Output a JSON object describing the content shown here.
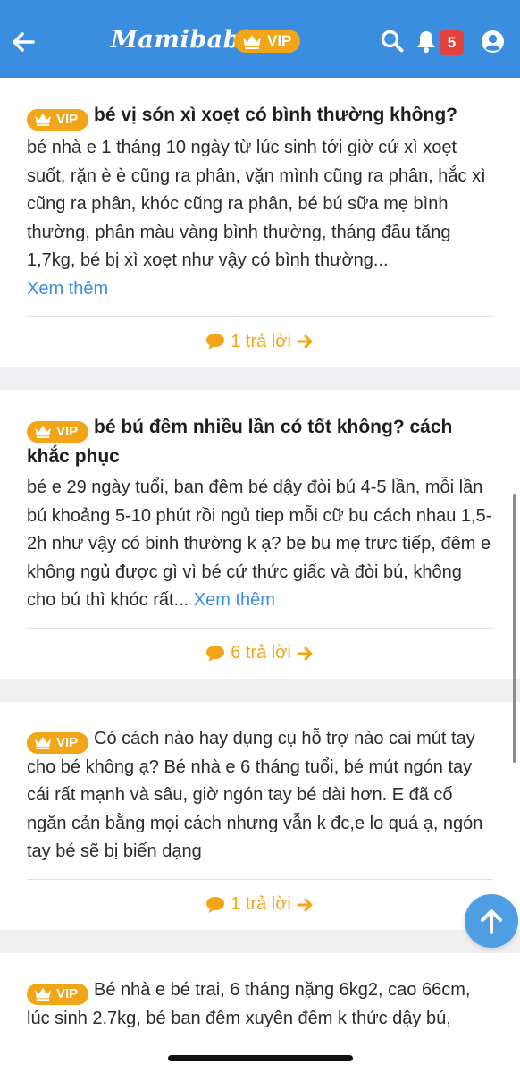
{
  "header": {
    "logo_text": "Mamibabi",
    "vip_label": "VIP",
    "notification_count": "5",
    "bg_color": "#3b8ddf",
    "accent_color": "#f2a516",
    "icons": [
      "arrow-left-icon",
      "crown-icon",
      "search-icon",
      "bell-icon",
      "user-icon"
    ]
  },
  "posts": [
    {
      "vip_label": "VIP",
      "title": "bé vị són xì xoẹt có bình thường không?",
      "body": "bé nhà e 1 tháng 10 ngày từ lúc sinh tới giờ cứ xì xoẹt suốt, rặn è è cũng ra phân, vặn mình cũng ra phân, hắc xì cũng ra phân, khóc cũng ra phân, bé bú sữa mẹ bình thường, phân màu vàng bình thường, tháng đầu tăng 1,7kg, bé bị xì xoẹt như vậy có bình thường...",
      "more": "Xem thêm",
      "replies": "1 trả lời"
    },
    {
      "vip_label": "VIP",
      "title": "bé bú đêm nhiều lần có tốt không? cách khắc phục",
      "body": "bé e 29 ngày tuổi, ban đêm bé dậy đòi bú 4-5 lần, mỗi lần bú khoảng 5-10 phút rồi ngủ tiep mỗi cữ bu cách nhau 1,5-2h như vậy có binh thường k ạ? be bu mẹ trưc tiếp, đêm e không ngủ được gì vì bé cứ thức giấc và đòi bú, không cho bú thì khóc rất...",
      "more": "Xem thêm",
      "replies": "6 trả lời"
    },
    {
      "vip_label": "VIP",
      "body": "Có cách nào hay dụng cụ hỗ trợ nào cai mút tay cho bé không ạ? Bé nhà e 6 tháng tuổi, bé mút ngón tay cái rất mạnh và sâu, giờ ngón tay bé dài hơn. E đã cố ngăn cản bằng mọi cách nhưng vẫn k đc,e lo quá ạ, ngón tay bé sẽ bị biến dạng",
      "replies": "1 trả lời"
    },
    {
      "vip_label": "VIP",
      "body": "Bé nhà e bé trai, 6 tháng nặng 6kg2, cao 66cm, lúc sinh 2.7kg, bé ban đêm xuyên đêm k thức dậy bú, nhưng ngủ k sâu giấc, lăn qua lăn lại nên e bế"
    }
  ]
}
